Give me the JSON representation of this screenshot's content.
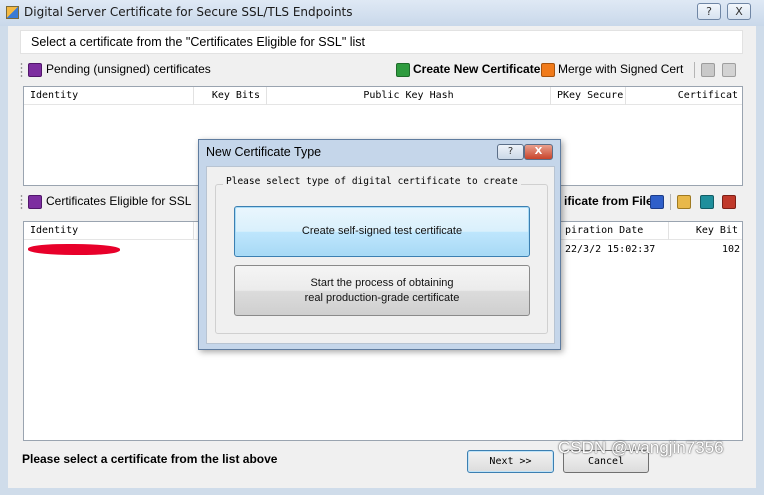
{
  "window": {
    "title": "Digital Server Certificate for Secure SSL/TLS Endpoints",
    "help_label": "?",
    "close_label": "X"
  },
  "instruction": "Select a certificate from the \"Certificates Eligible for SSL\" list",
  "pending": {
    "title": "Pending (unsigned) certificates",
    "create_label": "Create New Certificate",
    "merge_label": "Merge with Signed Cert",
    "columns": [
      "Identity",
      "Key Bits",
      "Public Key Hash",
      "PKey Secure",
      "Certificat"
    ]
  },
  "eligible": {
    "title": "Certificates Eligible for SSL",
    "import_label": "ificate from File",
    "columns": [
      "Identity",
      "",
      "",
      "piration Date",
      "Key Bit"
    ],
    "rows": [
      {
        "identity": "",
        "expiration": "22/3/2 15:02:37",
        "key_bits": "102"
      }
    ]
  },
  "status_text": "Please select a certificate from the list above",
  "buttons": {
    "next": "Next >>",
    "cancel": "Cancel"
  },
  "watermark": "CSDN @wangjin7356",
  "modal": {
    "title": "New Certificate Type",
    "help_label": "?",
    "close_label": "X",
    "group_label": "Please select type of digital certificate to create",
    "option_self_signed": "Create self-signed test certificate",
    "option_production_line1": "Start the process of obtaining",
    "option_production_line2": "real production-grade certificate"
  },
  "colors": {
    "accent": "#3c7fb1",
    "create_icon": "#2e9b3e",
    "merge_icon": "#f07a1a",
    "delete_icon": "#c0392b",
    "redaction": "#e8002a"
  }
}
